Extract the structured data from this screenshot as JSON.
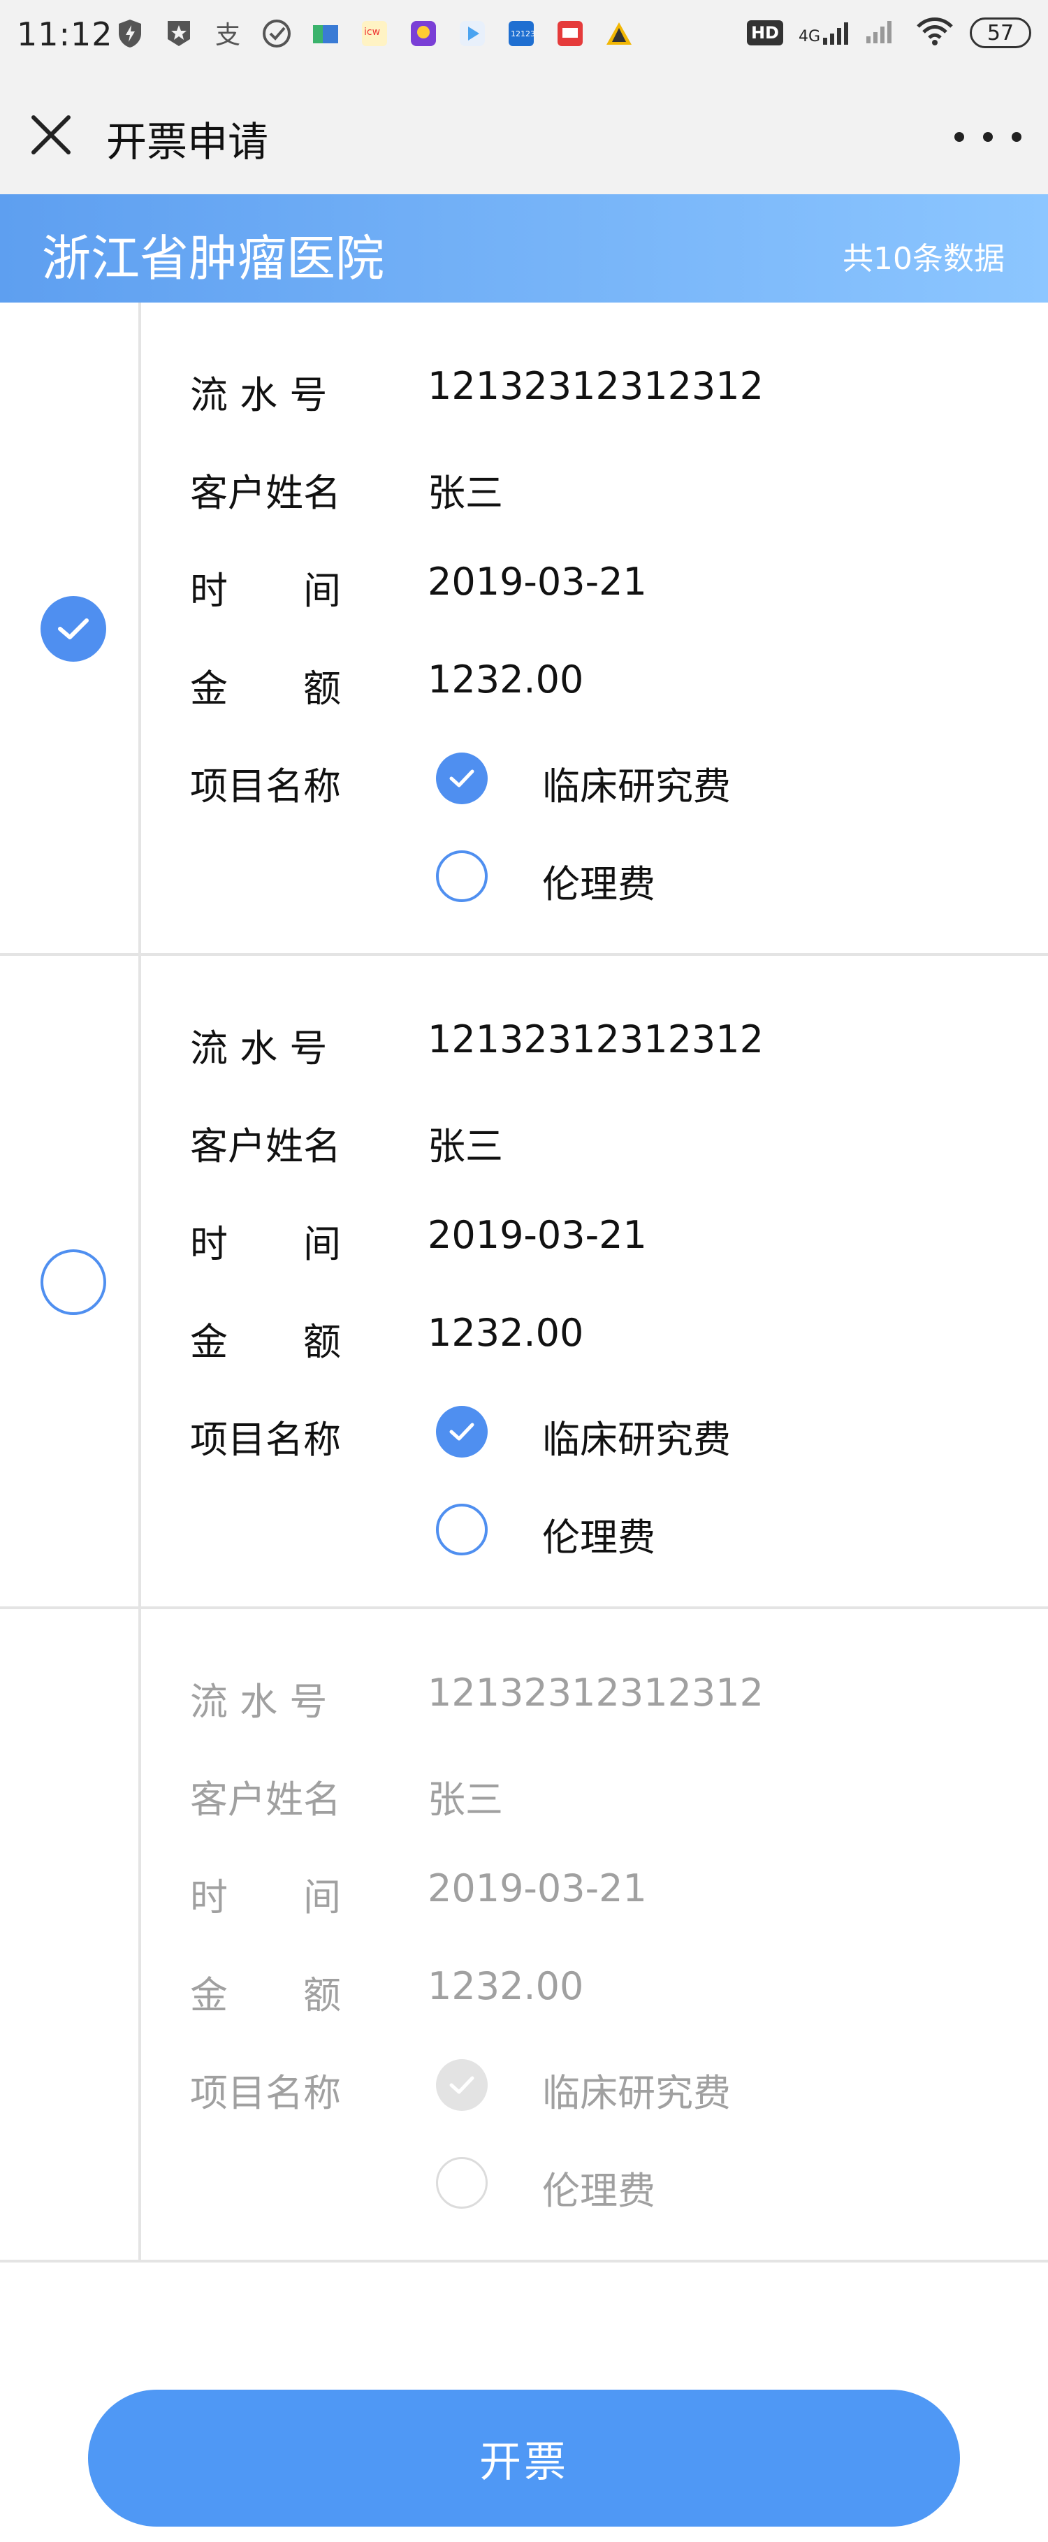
{
  "status_bar": {
    "time": "11:12",
    "hd_label": "HD",
    "network_label": "4G",
    "battery": "57",
    "app_icons": [
      "shield-icon",
      "star-badge-icon",
      "alipay-icon",
      "check-circle-icon",
      "map-icon",
      "news-app-icon",
      "avatar-app-icon",
      "video-app-icon",
      "traffic-12123-icon",
      "mail-app-icon",
      "alert-triangle-icon"
    ]
  },
  "nav": {
    "title": "开票申请"
  },
  "banner": {
    "hospital": "浙江省肿瘤医院",
    "count": "共10条数据"
  },
  "field_labels": {
    "serial": "流 水 号",
    "customer": "客户姓名",
    "time": "时　　间",
    "amount": "金　　额",
    "item": "项目名称"
  },
  "records": [
    {
      "selected": true,
      "disabled": false,
      "serial": "12132312312312",
      "customer": "张三",
      "time": "2019-03-21",
      "amount": "1232.00",
      "items": [
        {
          "name": "临床研究费",
          "checked": true
        },
        {
          "name": "伦理费",
          "checked": false
        }
      ]
    },
    {
      "selected": false,
      "disabled": false,
      "serial": "12132312312312",
      "customer": "张三",
      "time": "2019-03-21",
      "amount": "1232.00",
      "items": [
        {
          "name": "临床研究费",
          "checked": true
        },
        {
          "name": "伦理费",
          "checked": false
        }
      ]
    },
    {
      "selected": false,
      "disabled": true,
      "serial": "12132312312312",
      "customer": "张三",
      "time": "2019-03-21",
      "amount": "1232.00",
      "items": [
        {
          "name": "临床研究费",
          "checked": true
        },
        {
          "name": "伦理费",
          "checked": false
        }
      ]
    }
  ],
  "submit_label": "开票",
  "colors": {
    "accent": "#4f8ff0",
    "banner_start": "#5e9ff0",
    "banner_end": "#8cc6ff",
    "disabled_text": "#a0a0a0"
  }
}
